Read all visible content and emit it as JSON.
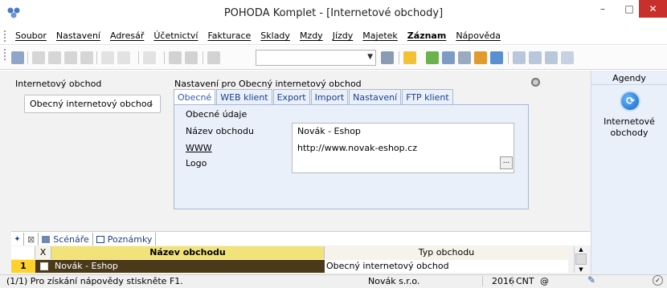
{
  "window": {
    "title": "POHODA Komplet - [Internetové obchody]",
    "controls": {
      "minimize": "–",
      "maximize": "□",
      "close": "✕"
    }
  },
  "menu": {
    "items": [
      {
        "label": "Soubor"
      },
      {
        "label": "Nastavení"
      },
      {
        "label": "Adresář"
      },
      {
        "label": "Účetnictví"
      },
      {
        "label": "Fakturace"
      },
      {
        "label": "Sklady"
      },
      {
        "label": "Mzdy"
      },
      {
        "label": "Jízdy"
      },
      {
        "label": "Majetek"
      },
      {
        "label": "Záznam",
        "bold": true
      },
      {
        "label": "Nápověda"
      }
    ]
  },
  "left": {
    "section_label": "Internetový obchod",
    "selected_shop": "Obecný internetový obchod"
  },
  "settings": {
    "heading": "Nastavení pro Obecný internetový obchod",
    "tabs": [
      "Obecné",
      "WEB klient",
      "Export",
      "Import",
      "Nastavení",
      "FTP klient"
    ],
    "active_tab": "Obecné",
    "group_title": "Obecné údaje",
    "labels": {
      "name": "Název obchodu",
      "www": "WWW",
      "logo": "Logo"
    },
    "values": {
      "name": "Novák - Eshop",
      "www": "http://www.novak-eshop.cz",
      "logo": ""
    },
    "logo_button": "..."
  },
  "bottom_tabs": {
    "scenarios": "Scénáře",
    "notes": "Poznámky"
  },
  "grid": {
    "columns": {
      "x": "X",
      "name": "Název obchodu",
      "type": "Typ obchodu"
    },
    "rows": [
      {
        "num": "1",
        "name": "Novák - Eshop",
        "type": "Obecný internetový obchod"
      }
    ]
  },
  "agendy": {
    "header": "Agendy",
    "item_label": "Internetové obchody"
  },
  "status": {
    "help": "(1/1) Pro získání nápovědy stiskněte F1.",
    "company": "Novák s.r.o.",
    "year": "2016",
    "mode": "CNT",
    "at": "@"
  },
  "colors": {
    "accent_tab_text": "#1a3e8c",
    "grid_header_active": "#f2e27a",
    "row_selected": "#4a3a1a",
    "row_number": "#ffd12e",
    "close_button": "#c9302c"
  }
}
